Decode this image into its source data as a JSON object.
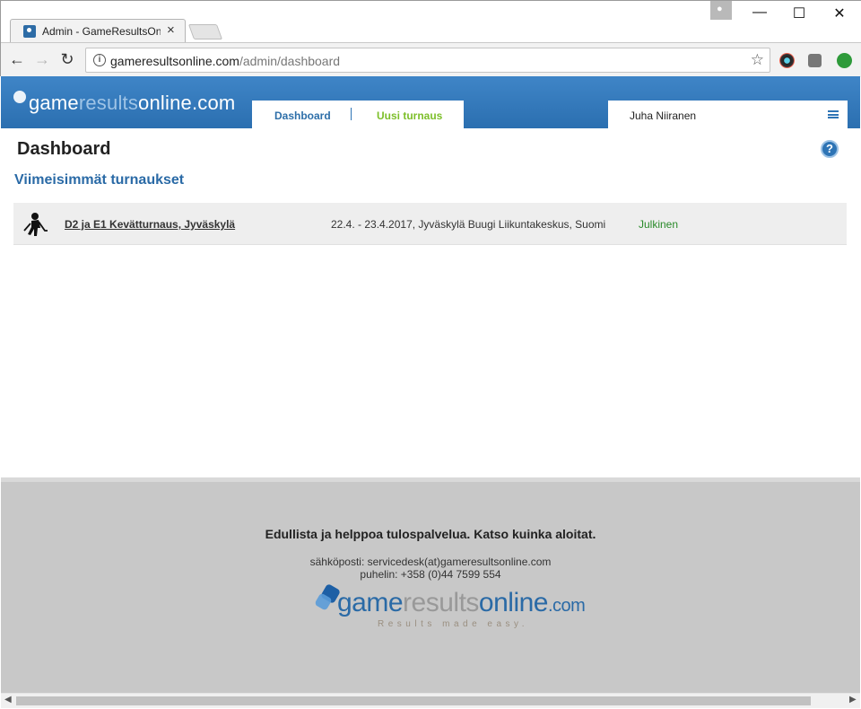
{
  "browser": {
    "tab_title": "Admin - GameResultsOnline",
    "tab_close": "×",
    "url_host": "gameresultsonline.com",
    "url_path": "/admin/dashboard",
    "window_minimize": "—",
    "window_maximize": "☐",
    "window_close": "✕"
  },
  "header": {
    "logo_game": "game",
    "logo_results": "results",
    "logo_online": "online.com",
    "nav": [
      {
        "label": "Dashboard",
        "color": "#2e6fa9"
      },
      {
        "label": "Uusi turnaus",
        "color": "#7dbf2a"
      }
    ],
    "user_name": "Juha Niiranen"
  },
  "main": {
    "page_title": "Dashboard",
    "help_label": "?",
    "section_title": "Viimeisimmät turnaukset",
    "tournaments": [
      {
        "name": "D2 ja E1 Kevätturnaus, Jyväskylä",
        "info": "22.4. - 23.4.2017, Jyväskylä Buugi Liikuntakeskus, Suomi",
        "status": "Julkinen",
        "icon": "hockey-player-icon"
      }
    ]
  },
  "footer": {
    "lead_text": "Edullista ja helppoa tulospalvelua. Katso ",
    "lead_link": "kuinka aloitat",
    "lead_end": ".",
    "email": "sähköposti: servicedesk(at)gameresultsonline.com",
    "phone": "puhelin: +358 (0)44 7599 554",
    "logo_game": "game",
    "logo_results": "results",
    "logo_online": "online",
    "logo_com": ".com",
    "tagline": "Results made easy."
  },
  "colors": {
    "header_blue": "#2e74b5",
    "nav_dashboard": "#2e6fa9",
    "nav_new": "#7dbf2a",
    "status_green": "#2a8a2a",
    "footer_bg": "#c8c8c8"
  }
}
